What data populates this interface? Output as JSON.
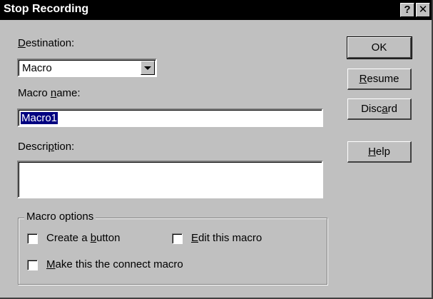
{
  "window": {
    "title": "Stop Recording",
    "help_glyph": "?",
    "close_glyph": "✕"
  },
  "destination": {
    "label_accel": "D",
    "label_rest": "estination:",
    "value": "Macro"
  },
  "macro_name": {
    "label_pre": "Macro ",
    "label_accel": "n",
    "label_post": "ame:",
    "value": "Macro1"
  },
  "description": {
    "label_pre": "Descri",
    "label_accel": "p",
    "label_post": "tion:",
    "value": ""
  },
  "buttons": {
    "ok": "OK",
    "resume_accel": "R",
    "resume_rest": "esume",
    "discard_pre": "Disc",
    "discard_accel": "a",
    "discard_post": "rd",
    "help_accel": "H",
    "help_rest": "elp"
  },
  "macro_options": {
    "legend": "Macro options",
    "create_button_pre": "Create a ",
    "create_button_accel": "b",
    "create_button_post": "utton",
    "edit_macro_accel": "E",
    "edit_macro_rest": "dit this macro",
    "connect_macro_accel": "M",
    "connect_macro_rest": "ake this the connect macro"
  }
}
